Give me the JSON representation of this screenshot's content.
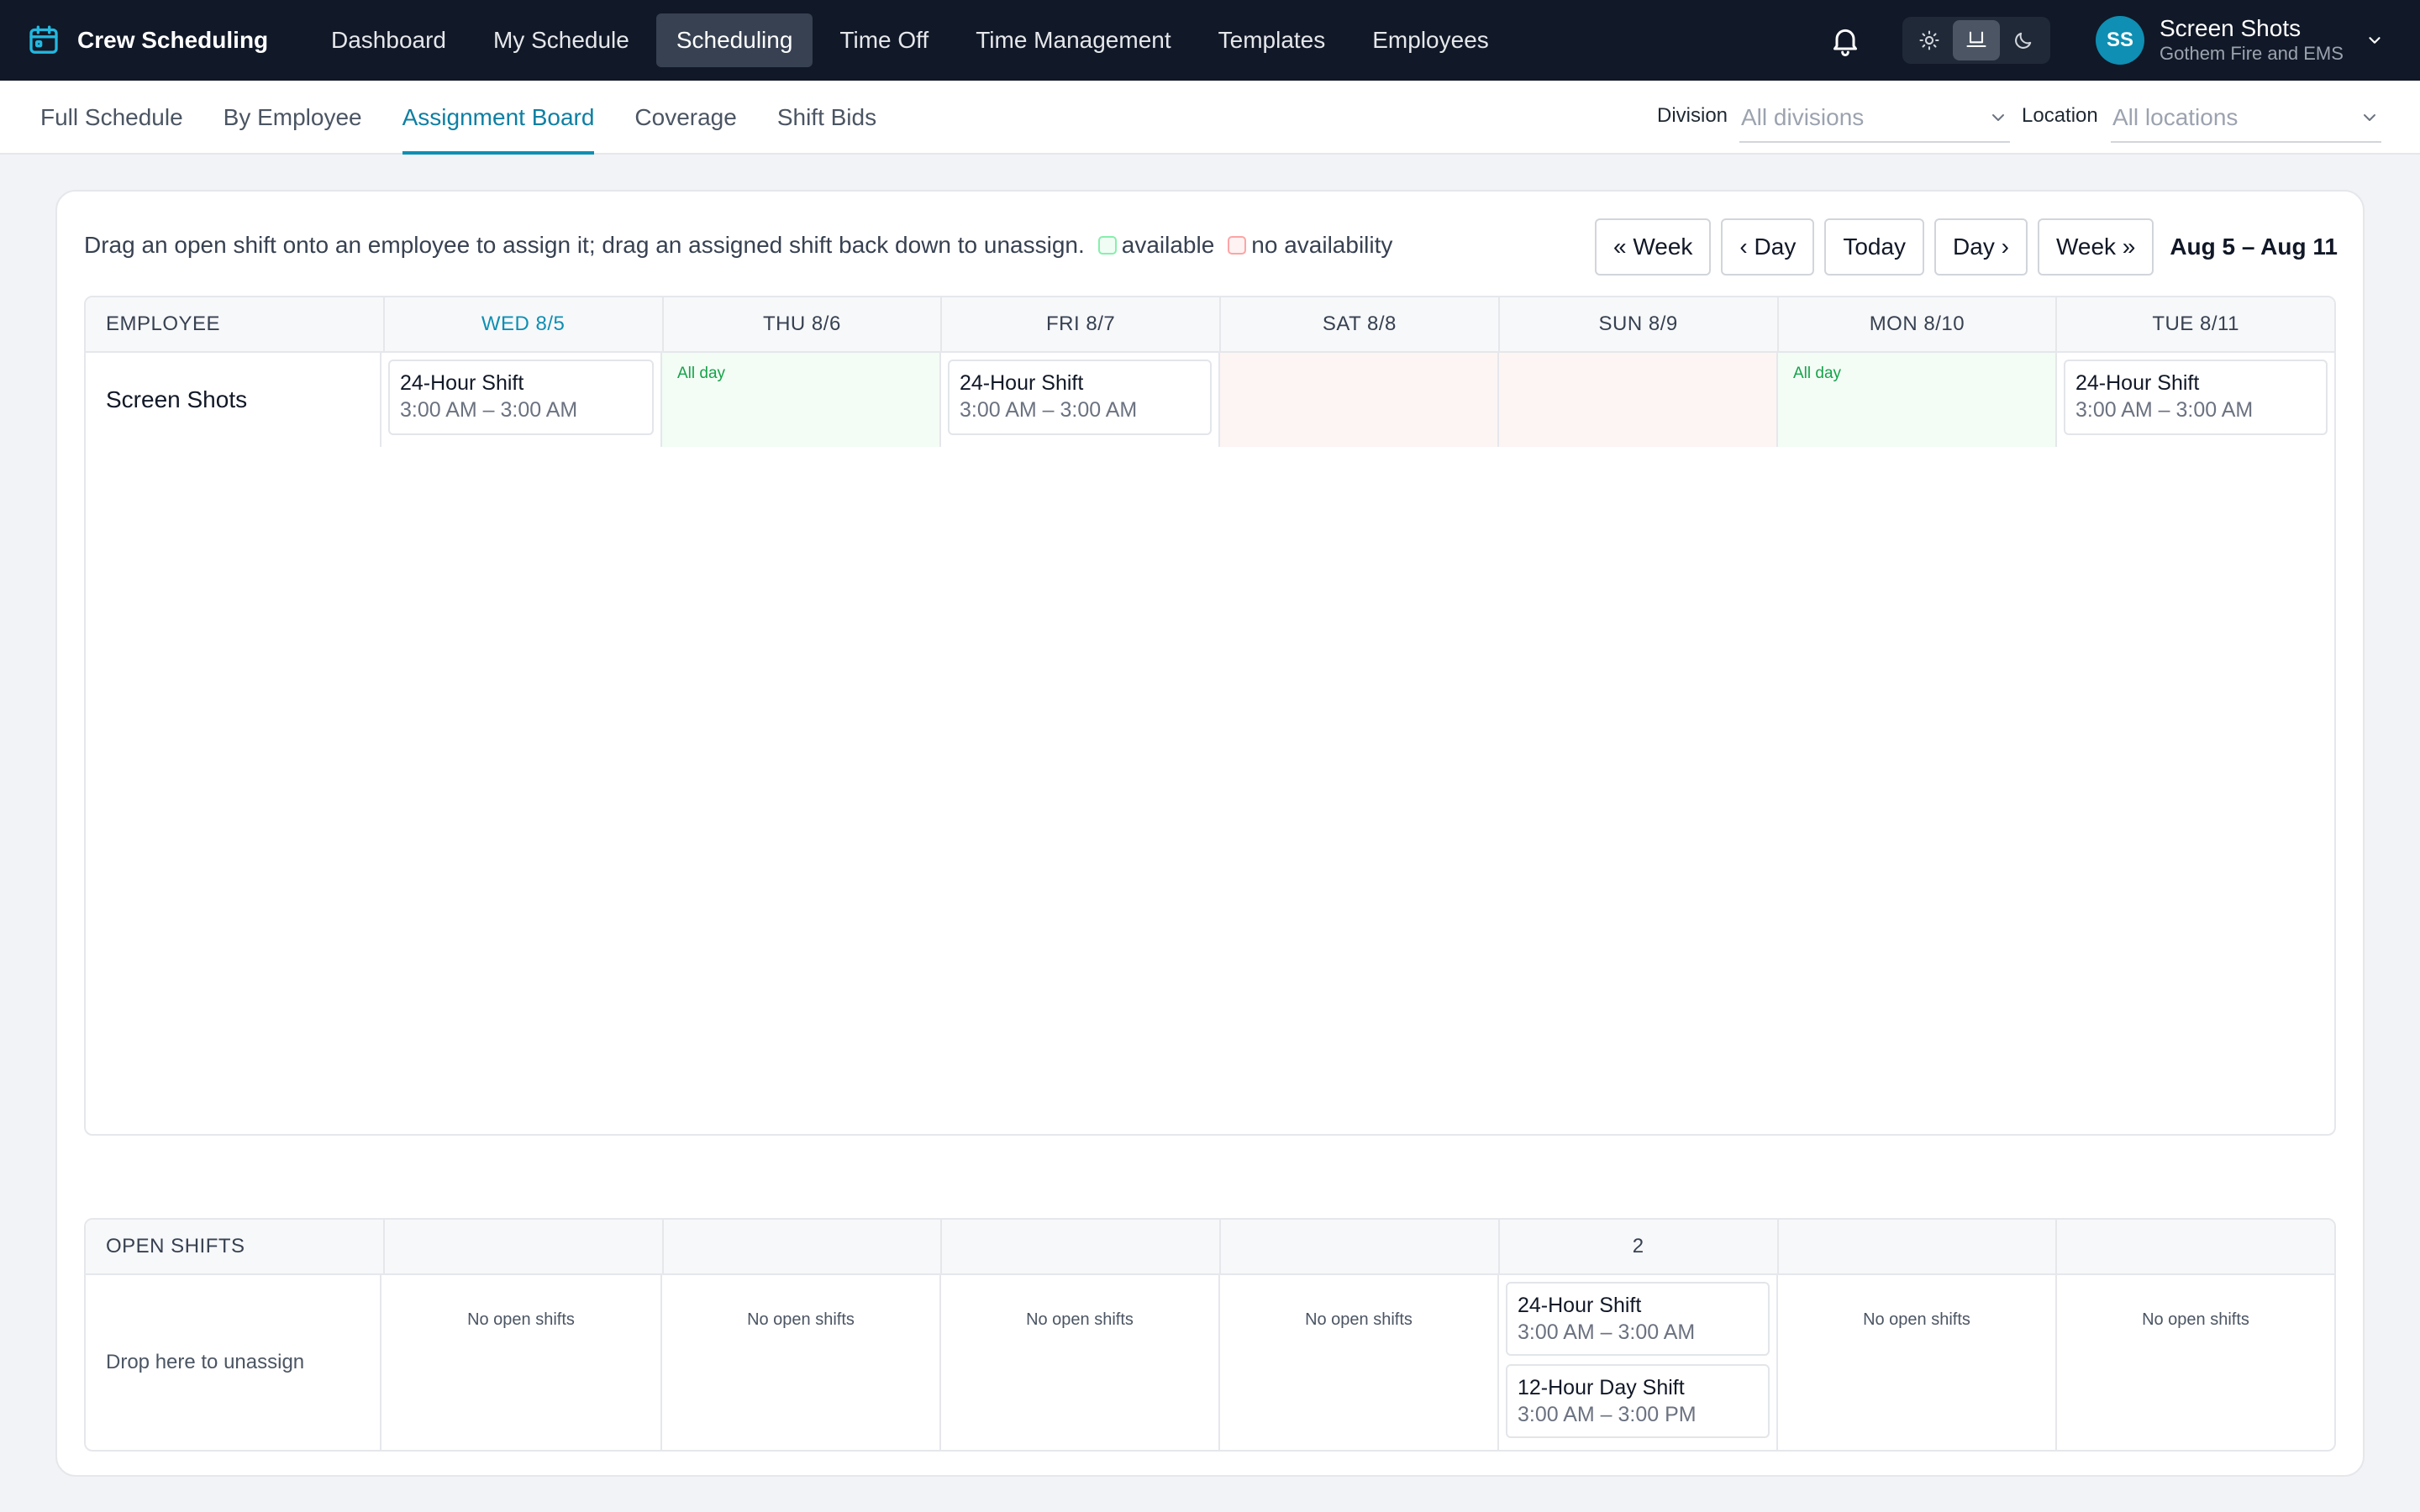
{
  "app": {
    "title": "Crew Scheduling"
  },
  "nav": {
    "items": [
      {
        "label": "Dashboard",
        "active": false
      },
      {
        "label": "My Schedule",
        "active": false
      },
      {
        "label": "Scheduling",
        "active": true
      },
      {
        "label": "Time Off",
        "active": false
      },
      {
        "label": "Time Management",
        "active": false
      },
      {
        "label": "Templates",
        "active": false
      },
      {
        "label": "Employees",
        "active": false
      }
    ]
  },
  "user": {
    "initials": "SS",
    "name": "Screen Shots",
    "org": "Gothem Fire and EMS"
  },
  "subnav": {
    "tabs": [
      {
        "label": "Full Schedule",
        "active": false
      },
      {
        "label": "By Employee",
        "active": false
      },
      {
        "label": "Assignment Board",
        "active": true
      },
      {
        "label": "Coverage",
        "active": false
      },
      {
        "label": "Shift Bids",
        "active": false
      }
    ]
  },
  "filters": {
    "division": {
      "label": "Division",
      "value": "All divisions"
    },
    "location": {
      "label": "Location",
      "value": "All locations"
    }
  },
  "board": {
    "instructions": "Drag an open shift onto an employee to assign it; drag an assigned shift back down to unassign.",
    "legend": {
      "available": "available",
      "unavailable": "no availability"
    },
    "buttons": {
      "prev_week": "« Week",
      "prev_day": "‹ Day",
      "today": "Today",
      "next_day": "Day ›",
      "next_week": "Week »"
    },
    "date_range": "Aug 5 – Aug 11",
    "employee_header": "EMPLOYEE",
    "days": [
      "WED 8/5",
      "THU 8/6",
      "FRI 8/7",
      "SAT 8/8",
      "SUN 8/9",
      "MON 8/10",
      "TUE 8/11"
    ],
    "employees": [
      {
        "name": "Screen Shots",
        "cells": [
          {
            "state": "shift",
            "shift": {
              "name": "24-Hour Shift",
              "time": "3:00 AM – 3:00 AM"
            }
          },
          {
            "state": "available",
            "label": "All day"
          },
          {
            "state": "shift",
            "shift": {
              "name": "24-Hour Shift",
              "time": "3:00 AM – 3:00 AM"
            }
          },
          {
            "state": "unavailable"
          },
          {
            "state": "unavailable"
          },
          {
            "state": "available",
            "label": "All day"
          },
          {
            "state": "shift",
            "shift": {
              "name": "24-Hour Shift",
              "time": "3:00 AM – 3:00 AM"
            }
          }
        ]
      }
    ]
  },
  "open_shifts": {
    "header": "OPEN SHIFTS",
    "drop_label": "Drop here to unassign",
    "empty_label": "No open shifts",
    "counts": [
      "",
      "",
      "",
      "",
      "2",
      "",
      ""
    ],
    "days": [
      [],
      [],
      [],
      [],
      [
        {
          "name": "24-Hour Shift",
          "time": "3:00 AM – 3:00 AM"
        },
        {
          "name": "12-Hour Day Shift",
          "time": "3:00 AM – 3:00 PM"
        }
      ],
      [],
      []
    ]
  },
  "colors": {
    "nav_bg": "#111827",
    "accent": "#0e8fb3",
    "available_bg": "#f3fcf5",
    "unavailable_bg": "#fdf4f4",
    "available_text": "#16a34a"
  }
}
